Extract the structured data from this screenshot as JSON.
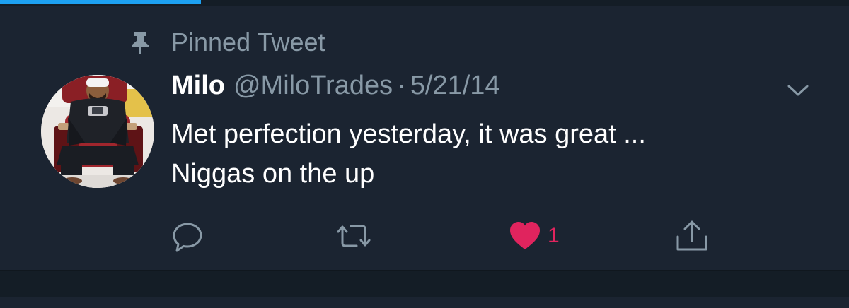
{
  "loading_bar": {
    "progress": 0.237,
    "color": "#1da1f2"
  },
  "pinned": {
    "label": "Pinned Tweet",
    "icon": "pin-icon"
  },
  "tweet": {
    "author_name": "Milo",
    "author_handle": "@MiloTrades",
    "separator": "·",
    "date": "5/21/14",
    "text_lines": [
      "Met perfection yesterday, it was great ...",
      "Niggas on the up"
    ],
    "menu_icon": "chevron-down-icon"
  },
  "actions": {
    "reply": {
      "icon": "reply-icon"
    },
    "retweet": {
      "icon": "retweet-icon"
    },
    "like": {
      "icon": "heart-icon",
      "count": "1",
      "liked": true
    },
    "share": {
      "icon": "share-icon"
    }
  },
  "colors": {
    "background": "#1b2431",
    "secondary_text": "#8899a6",
    "like": "#e0245e",
    "accent": "#1da1f2"
  }
}
